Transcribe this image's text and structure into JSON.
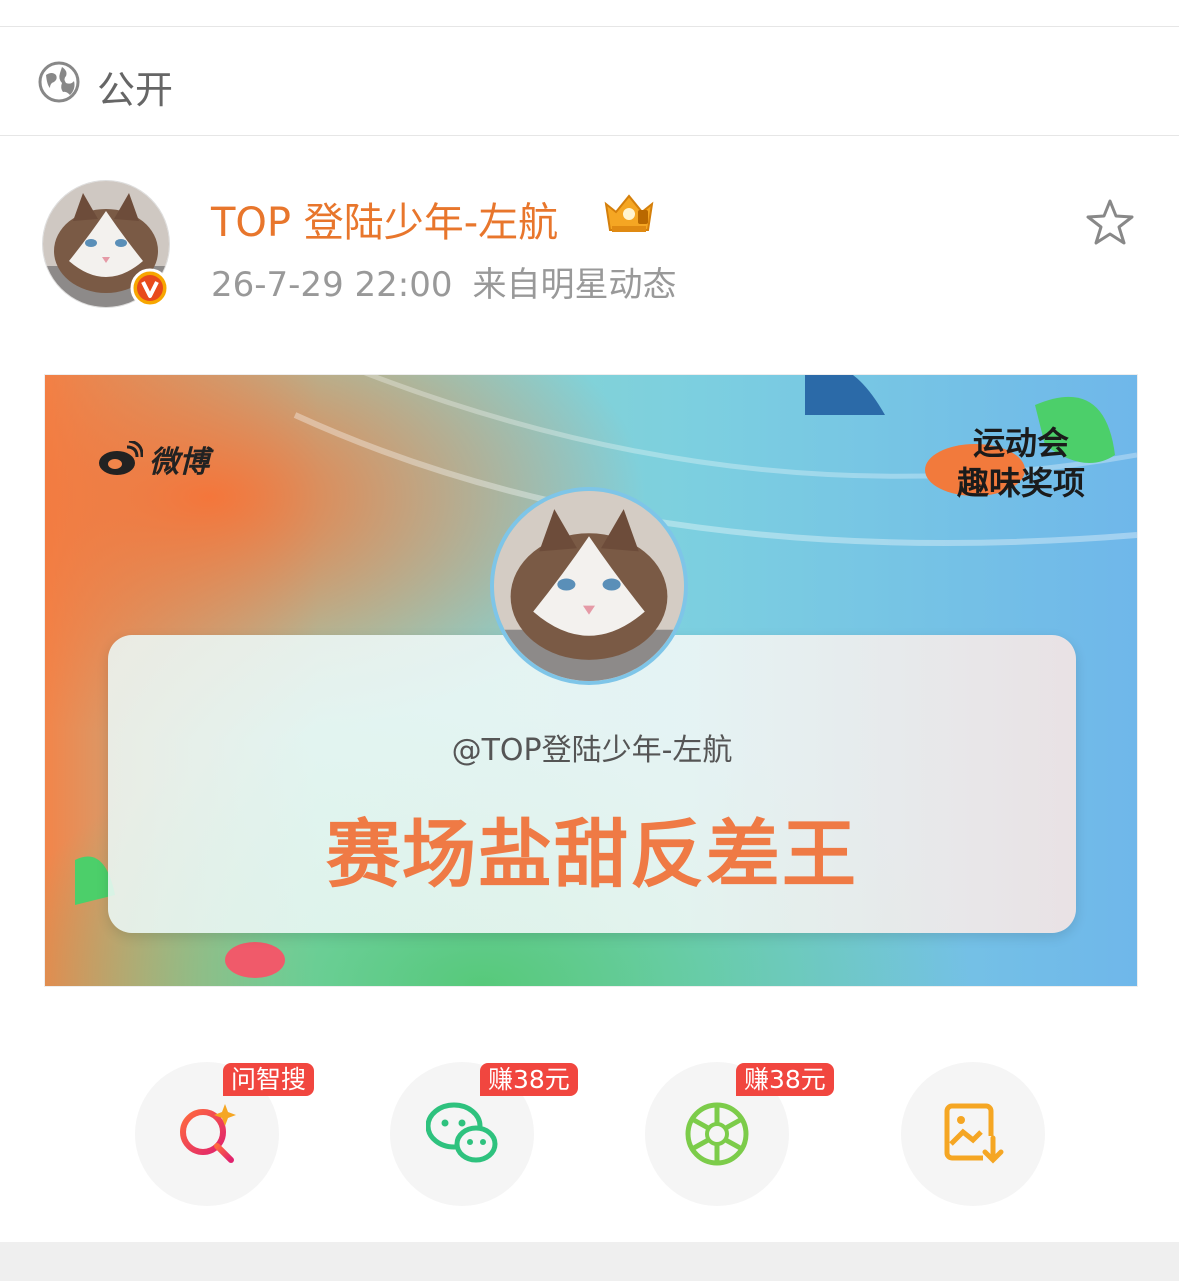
{
  "visibility": {
    "label": "公开",
    "icon": "globe-icon"
  },
  "post": {
    "author": "TOP 登陆少年-左航",
    "timestamp": "26-7-29 22:00",
    "source": "来自明星动态",
    "verified_icon": "verified-v-icon",
    "crown_icon": "crown-icon",
    "favorite_icon": "star-icon"
  },
  "banner": {
    "logo_text": "微博",
    "badge_line1": "运动会",
    "badge_line2": "趣味奖项",
    "handle": "@TOP登陆少年-左航",
    "award": "赛场盐甜反差王"
  },
  "actions": [
    {
      "icon": "ai-search-icon",
      "tag": "问智搜"
    },
    {
      "icon": "wechat-icon",
      "tag": "赚38元"
    },
    {
      "icon": "moments-icon",
      "tag": "赚38元"
    },
    {
      "icon": "save-image-icon",
      "tag": ""
    }
  ],
  "colors": {
    "username": "#e8762c",
    "tag_bg": "#f1463f",
    "award": "#ef7a45"
  }
}
